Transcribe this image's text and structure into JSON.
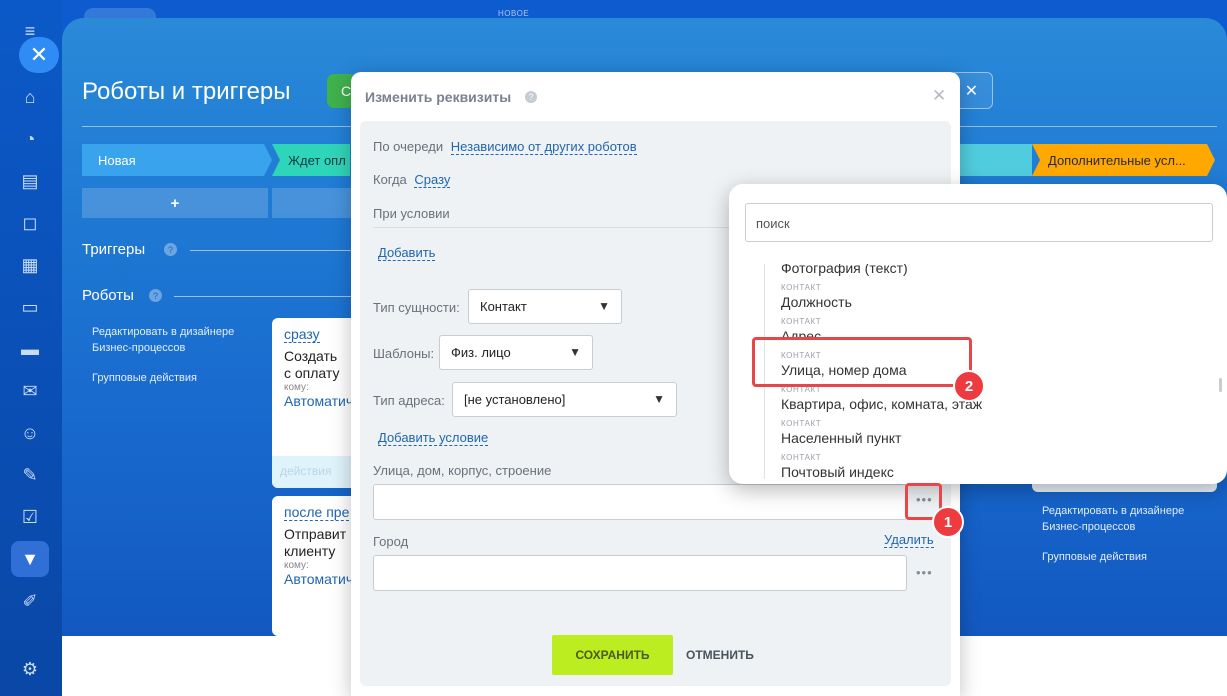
{
  "topbar": {
    "new_label": "НОВОЕ"
  },
  "page": {
    "title": "Роботы и триггеры",
    "green_btn_char": "С",
    "close_char": "✕"
  },
  "stages": {
    "new": "Новая",
    "wait": "Ждет опл",
    "extra": "Дополнительные усл..."
  },
  "plus": "+",
  "triggers_title": "Триггеры",
  "robots_title": "Роботы",
  "left_links": {
    "edit": "Редактировать в дизайнере Бизнес-процессов",
    "group": "Групповые действия"
  },
  "right_links": {
    "edit": "Редактировать в дизайнере Бизнес-процессов",
    "group": "Групповые действия"
  },
  "cards": [
    {
      "when": "сразу",
      "title": "Создать с оплату",
      "to": "кому:",
      "auto": "Автоматич",
      "actions": "действия"
    },
    {
      "when": "после пре",
      "title": "Отправит клиенту",
      "to": "кому:",
      "auto": "Автоматич"
    }
  ],
  "modal": {
    "title": "Изменить реквизиты",
    "queue_label": "По очереди",
    "queue_value": "Независимо от других роботов",
    "when_label": "Когда",
    "when_value": "Сразу",
    "condition_label": "При условии",
    "add_label": "Добавить",
    "entity_label": "Тип сущности:",
    "entity_value": "Контакт",
    "template_label": "Шаблоны:",
    "template_value": "Физ. лицо",
    "address_label": "Тип адреса:",
    "address_value": "[не установлено]",
    "add_condition": "Добавить условие",
    "street_label": "Улица, дом, корпус, строение",
    "street_value": "",
    "city_label": "Город",
    "city_value": "",
    "delete_label": "Удалить",
    "save": "СОХРАНИТЬ",
    "cancel": "ОТМЕНИТЬ"
  },
  "popup": {
    "search_placeholder": "поиск",
    "items": [
      {
        "group": "",
        "text": "Фотография (текст)"
      },
      {
        "group": "КОНТАКТ",
        "text": "Должность"
      },
      {
        "group": "КОНТАКТ",
        "text": "Адрес"
      },
      {
        "group": "КОНТАКТ",
        "text": "Улица, номер дома"
      },
      {
        "group": "КОНТАКТ",
        "text": "Квартира, офис, комната, этаж"
      },
      {
        "group": "КОНТАКТ",
        "text": "Населенный пункт"
      },
      {
        "group": "КОНТАКТ",
        "text": "Почтовый индекс"
      }
    ]
  },
  "badges": {
    "one": "1",
    "two": "2"
  },
  "colors": {
    "accent_green": "#bbed21",
    "highlight_red": "#e8474a",
    "stage_orange": "#ffa900"
  }
}
